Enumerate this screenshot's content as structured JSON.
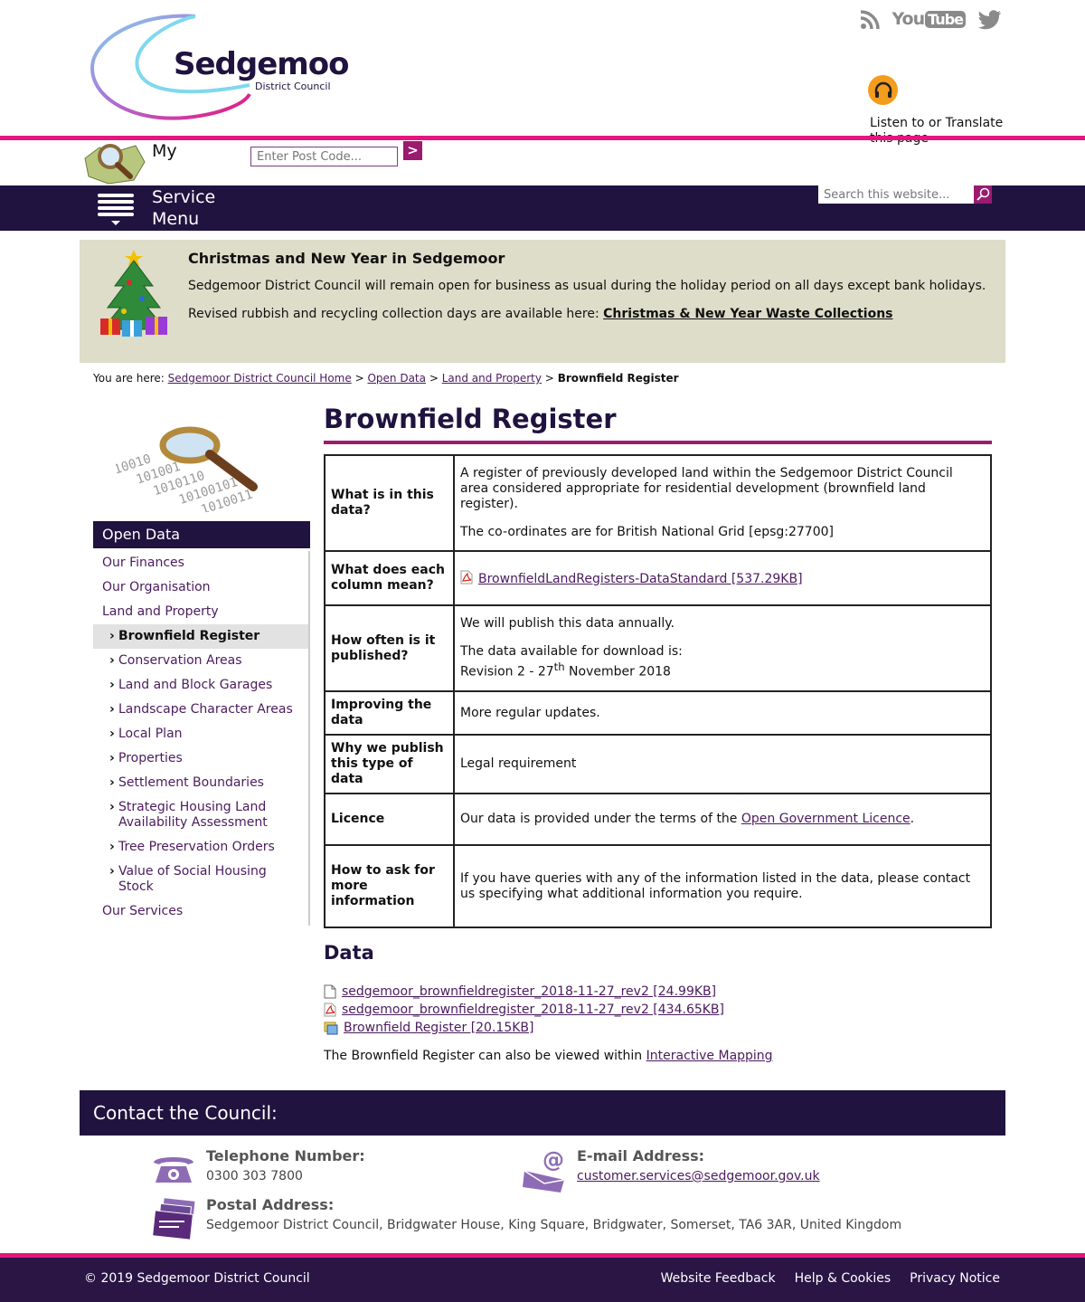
{
  "header": {
    "logo_name": "Sedgemoor",
    "logo_sub": "District Council",
    "social": [
      "rss-icon",
      "youtube-icon",
      "twitter-icon"
    ],
    "youtube_label": "You",
    "youtube_tube": "Tube",
    "listen_label": "Listen to or Translate this page"
  },
  "myarea": {
    "label": "My",
    "postcode_placeholder": "Enter Post Code...",
    "go_label": ">"
  },
  "nav": {
    "menu_line1": "Service",
    "menu_line2": "Menu",
    "search_placeholder": "Search this website..."
  },
  "banner": {
    "title": "Christmas and New Year in Sedgemoor",
    "p1": "Sedgemoor District Council will remain open for business as usual during the holiday period on all days except bank holidays.",
    "p2_prefix": "Revised rubbish and recycling collection days are available here: ",
    "p2_link": "Christmas & New Year Waste Collections"
  },
  "breadcrumb": {
    "prefix": "You are here:",
    "items": [
      "Sedgemoor District Council Home",
      "Open Data",
      "Land and Property"
    ],
    "sep": ">",
    "current": "Brownfield Register"
  },
  "sidebar": {
    "heading": "Open Data",
    "items": [
      {
        "label": "Our Finances"
      },
      {
        "label": "Our Organisation"
      },
      {
        "label": "Land and Property"
      },
      {
        "label": "Brownfield Register"
      },
      {
        "label": "Conservation Areas"
      },
      {
        "label": "Land and Block Garages"
      },
      {
        "label": "Landscape Character Areas"
      },
      {
        "label": "Local Plan"
      },
      {
        "label": "Properties"
      },
      {
        "label": "Settlement Boundaries"
      },
      {
        "label": "Strategic Housing Land Availability Assessment"
      },
      {
        "label": "Tree Preservation Orders"
      },
      {
        "label": "Value of Social Housing Stock"
      },
      {
        "label": "Our Services"
      }
    ]
  },
  "main": {
    "title": "Brownfield Register",
    "rows": {
      "what_k": "What is in this data?",
      "what_v1": "A register of previously developed land within the Sedgemoor District Council area considered appropriate for residential development (brownfield land register).",
      "what_v2": "The co-ordinates are for British National Grid [epsg:27700]",
      "cols_k": "What does each column mean?",
      "cols_link": "BrownfieldLandRegisters-DataStandard [537.29KB]",
      "often_k": "How often is it published?",
      "often_v1": "We will publish this data annually.",
      "often_v2": "The data available for download is:",
      "often_v3_pre": "Revision 2 - 27",
      "often_v3_sup": "th",
      "often_v3_post": " November 2018",
      "improve_k": "Improving the data",
      "improve_v": "More regular updates.",
      "why_k": "Why we publish this type of data",
      "why_v": "Legal requirement",
      "licence_k": "Licence",
      "licence_pre": "Our data is provided under the terms of the ",
      "licence_link": "Open Government Licence",
      "licence_post": ".",
      "ask_k": "How to ask for more information",
      "ask_v": "If you have queries with any of the information listed in the data, please contact us specifying what additional information you require."
    },
    "data_heading": "Data",
    "files": [
      {
        "label": "sedgemoor_brownfieldregister_2018-11-27_rev2 [24.99KB]",
        "icon": "file-icon"
      },
      {
        "label": "sedgemoor_brownfieldregister_2018-11-27_rev2 [434.65KB]",
        "icon": "pdf-icon"
      },
      {
        "label": "Brownfield Register [20.15KB]",
        "icon": "map-file-icon"
      }
    ],
    "also_pre": "The Brownfield Register can also be viewed within ",
    "also_link": "Interactive Mapping"
  },
  "contact": {
    "heading": "Contact the Council:",
    "phone_label": "Telephone Number:",
    "phone": "0300 303 7800",
    "email_label": "E-mail Address:",
    "email": "customer.services@sedgemoor.gov.uk",
    "postal_label": "Postal Address:",
    "postal": "Sedgemoor District Council, Bridgwater House, King Square, Bridgwater, Somerset, TA6 3AR, United Kingdom"
  },
  "footer": {
    "copyright": "© 2019 Sedgemoor District Council",
    "links": [
      "Website Feedback",
      "Help & Cookies",
      "Privacy Notice"
    ]
  },
  "colors": {
    "brand_dark": "#20133f",
    "brand_pink": "#e5157d",
    "brand_purple": "#9a1b6f",
    "banner_bg": "#ddddc9"
  }
}
